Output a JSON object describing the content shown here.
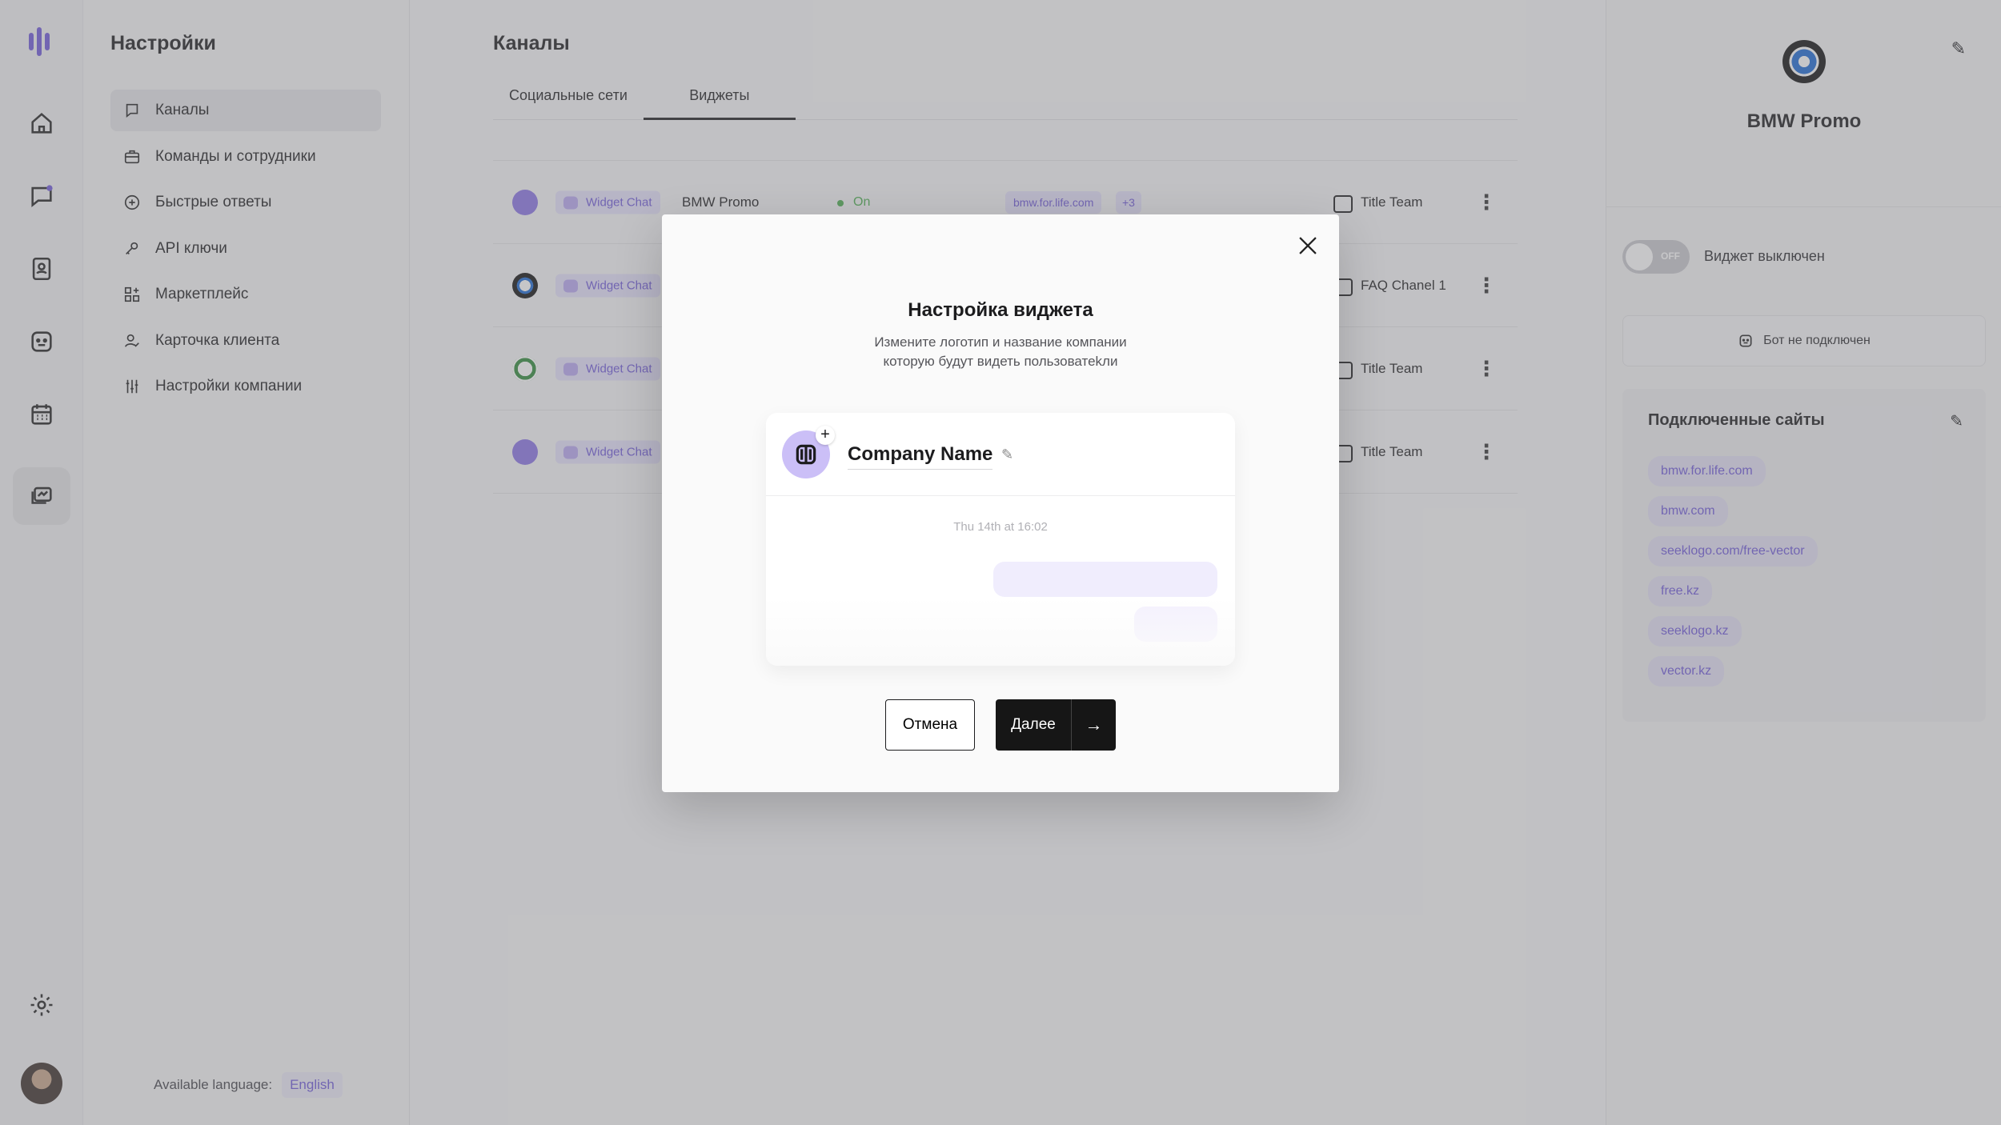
{
  "sidebar": {
    "title": "Настройки",
    "items": [
      {
        "label": "Каналы",
        "icon": "chat-square-icon"
      },
      {
        "label": "Команды и сотрудники",
        "icon": "briefcase-icon"
      },
      {
        "label": "Быстрые ответы",
        "icon": "bolt-circle-icon"
      },
      {
        "label": "API ключи",
        "icon": "key-icon"
      },
      {
        "label": "Маркетплейс",
        "icon": "apps-grid-icon"
      },
      {
        "label": "Карточка клиента",
        "icon": "user-card-icon"
      },
      {
        "label": "Настройки компании",
        "icon": "sliders-icon"
      }
    ],
    "language_label": "Available language:",
    "language_value": "English"
  },
  "main": {
    "title": "Каналы",
    "tabs": [
      {
        "label": "Социальные сети"
      },
      {
        "label": "Виджеты"
      }
    ],
    "rows": [
      {
        "tag": "Widget Chat",
        "name": "BMW Promo",
        "status": "On",
        "site": "bmw.for.life.com",
        "more": "+3",
        "team": "Title Team"
      },
      {
        "tag": "Widget Chat",
        "team": "FAQ Chanel 1"
      },
      {
        "tag": "Widget Chat",
        "team": "Title Team"
      },
      {
        "tag": "Widget Chat",
        "team": "Title Team"
      }
    ]
  },
  "right_panel": {
    "brand_name": "BMW Promo",
    "toggle_text": "OFF",
    "toggle_label": "Виджет выключен",
    "bot_status": "Бот не подключен",
    "sites_title": "Подключенные сайты",
    "sites": [
      "bmw.for.life.com",
      "bmw.com",
      "seeklogo.com/free-vector",
      "free.kz",
      "seeklogo.kz",
      "vector.kz"
    ]
  },
  "modal": {
    "title": "Настройка виджета",
    "description_line1": "Измените логотип и название компании",
    "description_line2": "которую будут видеть пользоватеkли",
    "company_name": "Company Name",
    "timestamp": "Thu 14th at 16:02",
    "cancel_label": "Отмена",
    "next_label": "Далее"
  },
  "colors": {
    "accent": "#6e59d9",
    "accent_light": "#e6e2fb",
    "status_on": "#4caf50",
    "dark": "#161616"
  }
}
